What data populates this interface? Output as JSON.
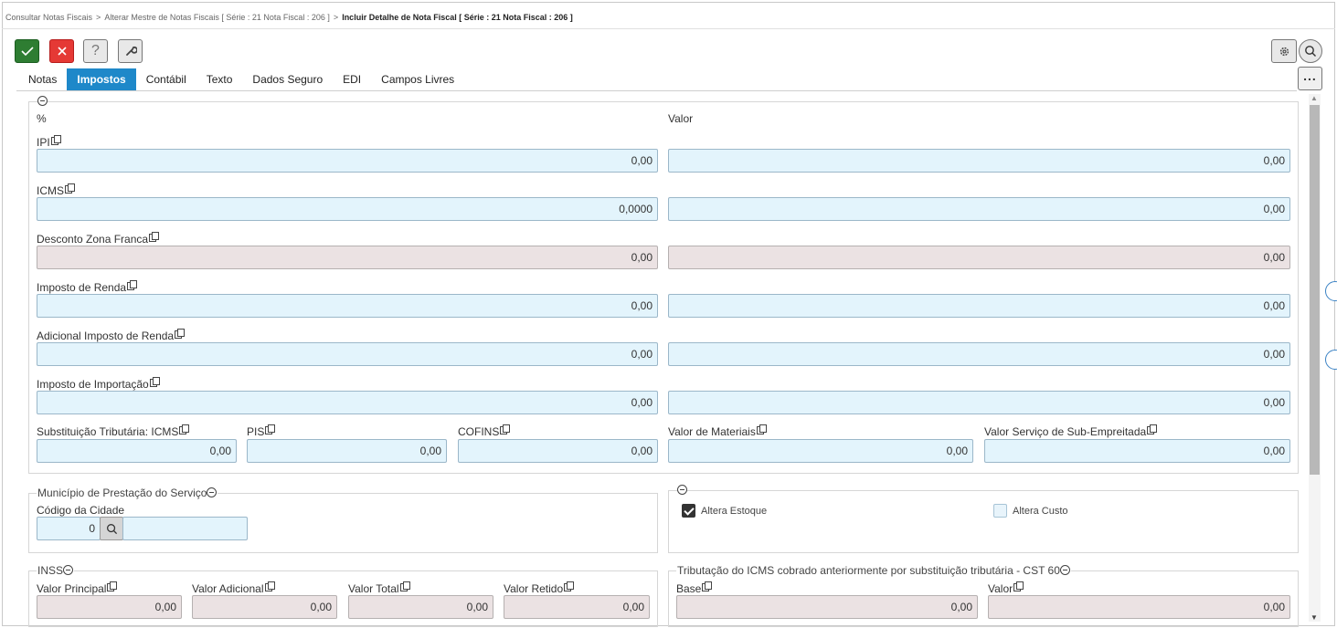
{
  "breadcrumb": {
    "item1": "Consultar Notas Fiscais",
    "item2": "Alterar Mestre de Notas Fiscais [ Série : 21 Nota Fiscal : 206 ]",
    "current": "Incluir Detalhe de Nota Fiscal [ Série : 21 Nota Fiscal : 206 ]",
    "separator": ">"
  },
  "toolbar": {
    "help_label": "?",
    "more_label": "..."
  },
  "tabs": [
    "Notas",
    "Impostos",
    "Contábil",
    "Texto",
    "Dados Seguro",
    "EDI",
    "Campos Livres"
  ],
  "taxes": {
    "percent_header": "%",
    "value_header": "Valor",
    "rows": [
      {
        "label": "IPI",
        "percent": "0,00",
        "value": "0,00"
      },
      {
        "label": "ICMS",
        "percent": "0,0000",
        "value": "0,00"
      },
      {
        "label": "Desconto Zona Franca",
        "percent": "0,00",
        "value": "0,00"
      },
      {
        "label": "Imposto de Renda",
        "percent": "0,00",
        "value": "0,00"
      },
      {
        "label": "Adicional Imposto de Renda",
        "percent": "0,00",
        "value": "0,00"
      },
      {
        "label": "Imposto de Importação",
        "percent": "0,00",
        "value": "0,00"
      }
    ],
    "small": [
      {
        "label": "Substituição Tributária: ICMS",
        "value": "0,00"
      },
      {
        "label": "PIS",
        "value": "0,00"
      },
      {
        "label": "COFINS",
        "value": "0,00"
      },
      {
        "label": "Valor de Materiais",
        "value": "0,00"
      },
      {
        "label": "Valor Serviço de Sub-Empreitada",
        "value": "0,00"
      }
    ]
  },
  "municipio": {
    "legend": "Município de Prestação do Serviço",
    "codigo_label": "Código da Cidade",
    "codigo_value": "0",
    "nome_value": ""
  },
  "estoque": {
    "altera_estoque": "Altera Estoque",
    "altera_estoque_checked": true,
    "altera_custo": "Altera Custo",
    "altera_custo_checked": false
  },
  "inss": {
    "legend": "INSS",
    "fields": [
      {
        "label": "Valor Principal",
        "value": "0,00"
      },
      {
        "label": "Valor Adicional",
        "value": "0,00"
      },
      {
        "label": "Valor Total",
        "value": "0,00"
      },
      {
        "label": "Valor Retido",
        "value": "0,00"
      }
    ]
  },
  "cst60": {
    "legend": "Tributação do ICMS cobrado anteriormente por substituição tributária - CST 60",
    "fields": [
      {
        "label": "Base",
        "value": "0,00"
      },
      {
        "label": "Valor",
        "value": "0,00"
      }
    ]
  }
}
